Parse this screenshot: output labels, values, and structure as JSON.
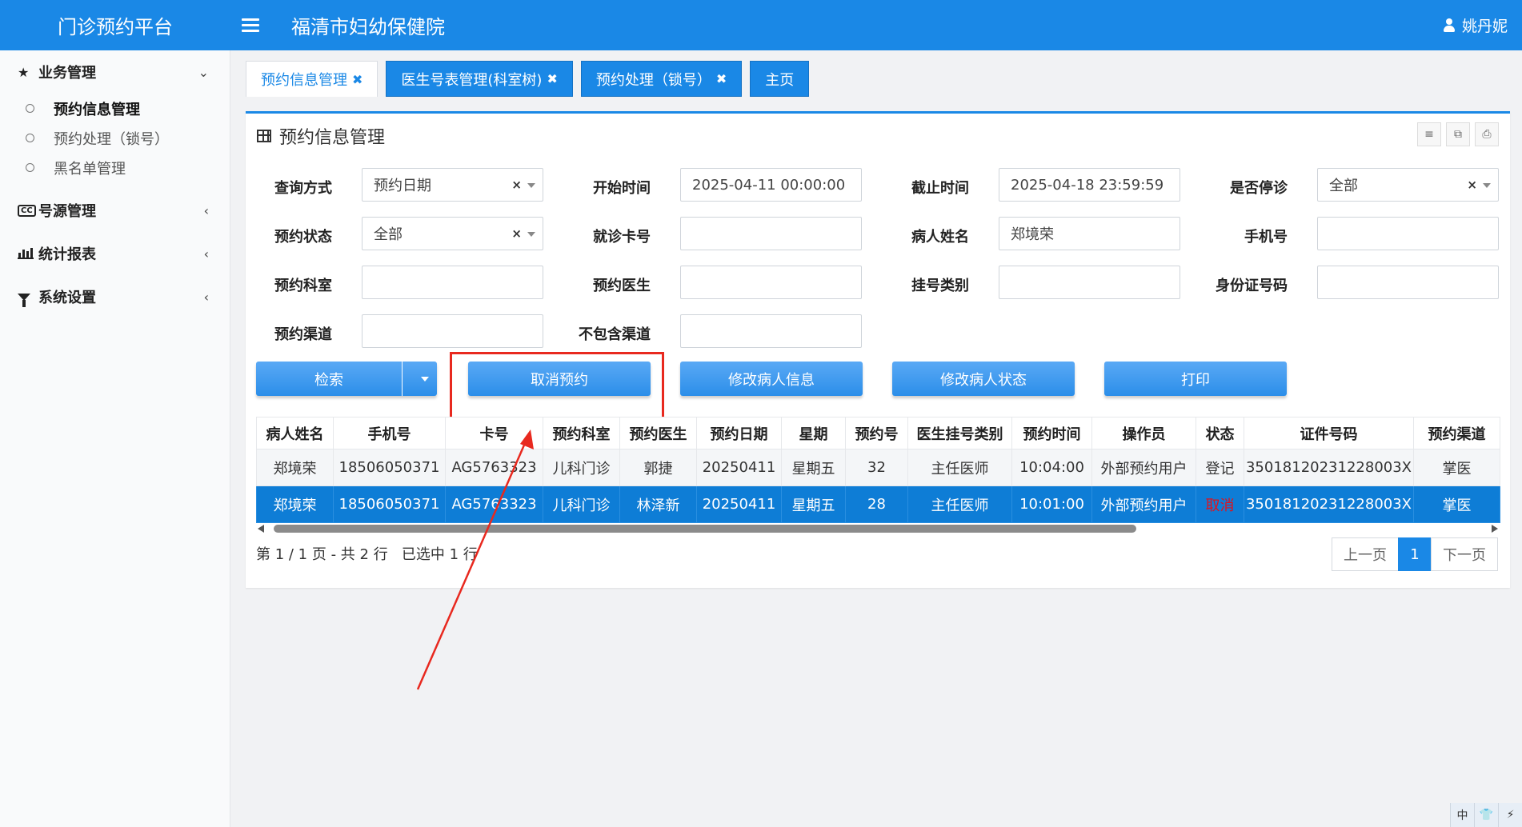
{
  "header": {
    "brand": "门诊预约平台",
    "hospital": "福清市妇幼保健院",
    "user": "姚丹妮"
  },
  "sidebar": {
    "groups": [
      {
        "label": "业务管理",
        "icon": "star-icon",
        "chevron": "⌄",
        "items": [
          {
            "label": "预约信息管理",
            "active": true
          },
          {
            "label": "预约处理（锁号）"
          },
          {
            "label": "黑名单管理"
          }
        ]
      },
      {
        "label": "号源管理",
        "icon": "cc-icon",
        "chevron": "‹"
      },
      {
        "label": "统计报表",
        "icon": "bar-chart-icon",
        "chevron": "‹"
      },
      {
        "label": "系统设置",
        "icon": "filter-icon",
        "chevron": "‹"
      }
    ]
  },
  "tabs": [
    {
      "label": "预约信息管理",
      "active": true,
      "close": "✖"
    },
    {
      "label": "医生号表管理(科室树)",
      "close": "✖"
    },
    {
      "label": "预约处理（锁号）",
      "close": "✖"
    },
    {
      "label": "主页"
    }
  ],
  "panel": {
    "title": "预约信息管理",
    "tools": [
      "≡",
      "⧉",
      "⎙"
    ]
  },
  "filters": {
    "query_mode": {
      "label": "查询方式",
      "value": "预约日期",
      "clear": "×"
    },
    "start_time": {
      "label": "开始时间",
      "value": "2025-04-11 00:00:00"
    },
    "end_time": {
      "label": "截止时间",
      "value": "2025-04-18 23:59:59"
    },
    "suspended": {
      "label": "是否停诊",
      "value": "全部",
      "clear": "×"
    },
    "status": {
      "label": "预约状态",
      "value": "全部",
      "clear": "×"
    },
    "card_no": {
      "label": "就诊卡号",
      "value": ""
    },
    "patient_name": {
      "label": "病人姓名",
      "value": "郑境荣"
    },
    "phone": {
      "label": "手机号",
      "value": ""
    },
    "department": {
      "label": "预约科室",
      "value": ""
    },
    "doctor": {
      "label": "预约医生",
      "value": ""
    },
    "reg_type": {
      "label": "挂号类别",
      "value": ""
    },
    "id_no": {
      "label": "身份证号码",
      "value": ""
    },
    "channel": {
      "label": "预约渠道",
      "value": ""
    },
    "exclude_channel": {
      "label": "不包含渠道",
      "value": ""
    }
  },
  "actions": {
    "search": "检索",
    "cancel": "取消预约",
    "edit_patient": "修改病人信息",
    "edit_status": "修改病人状态",
    "print": "打印"
  },
  "table": {
    "columns": [
      "病人姓名",
      "手机号",
      "卡号",
      "预约科室",
      "预约医生",
      "预约日期",
      "星期",
      "预约号",
      "医生挂号类别",
      "预约时间",
      "操作员",
      "状态",
      "证件号码",
      "预约渠道"
    ],
    "rows": [
      [
        "郑境荣",
        "18506050371",
        "AG5763323",
        "儿科门诊",
        "郭捷",
        "20250411",
        "星期五",
        "32",
        "主任医师",
        "10:04:00",
        "外部预约用户",
        "登记",
        "35018120231228003X",
        "掌医"
      ],
      [
        "郑境荣",
        "18506050371",
        "AG5763323",
        "儿科门诊",
        "林泽新",
        "20250411",
        "星期五",
        "28",
        "主任医师",
        "10:01:00",
        "外部预约用户",
        "取消",
        "35018120231228003X",
        "掌医"
      ]
    ],
    "selected_row": 1
  },
  "pagination": {
    "info": "第 1 / 1 页 - 共 2 行   已选中 1 行",
    "prev": "上一页",
    "current": "1",
    "next": "下一页"
  },
  "tray": [
    "中",
    "👕",
    "⚡"
  ],
  "colors": {
    "primary": "#1a88e6",
    "highlight": "#e8291f",
    "cancel_status": "#e0121b"
  }
}
